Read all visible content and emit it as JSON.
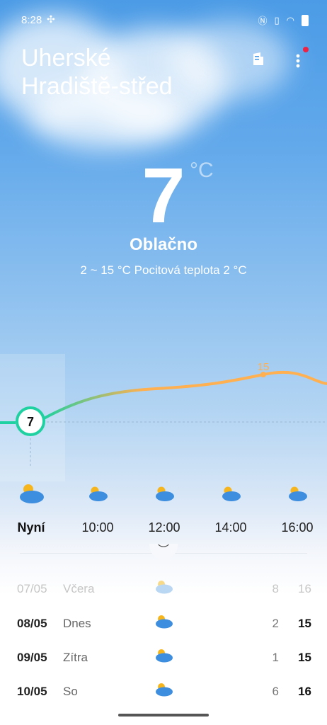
{
  "status": {
    "time": "8:28",
    "icons": [
      "fan-icon",
      "nfc-icon",
      "vibrate-icon",
      "wifi-icon",
      "battery-icon"
    ]
  },
  "header": {
    "city_line1": "Uherské",
    "city_line2": "Hradiště-střed",
    "notification_dot_color": "#ee2244"
  },
  "current": {
    "temp": "7",
    "unit": "°C",
    "condition": "Oblačno",
    "range": "2 ~ 15 °C  Pocitová teplota 2 °C"
  },
  "hourly": {
    "now_temp": "7",
    "peak_label": "15",
    "items": [
      {
        "label": "Nyní",
        "icon": "partly-cloudy-icon"
      },
      {
        "label": "10:00",
        "icon": "partly-cloudy-icon"
      },
      {
        "label": "12:00",
        "icon": "partly-cloudy-icon"
      },
      {
        "label": "14:00",
        "icon": "partly-cloudy-icon"
      },
      {
        "label": "16:00",
        "icon": "partly-cloudy-icon"
      }
    ]
  },
  "daily": [
    {
      "date": "07/05",
      "name": "Včera",
      "low": "8",
      "high": "16",
      "icon": "partly-cloudy-icon"
    },
    {
      "date": "08/05",
      "name": "Dnes",
      "low": "2",
      "high": "15",
      "icon": "partly-cloudy-icon"
    },
    {
      "date": "09/05",
      "name": "Zítra",
      "low": "1",
      "high": "15",
      "icon": "partly-cloudy-icon"
    },
    {
      "date": "10/05",
      "name": "So",
      "low": "6",
      "high": "16",
      "icon": "partly-cloudy-icon"
    }
  ],
  "colors": {
    "sky_top": "#4b9be6",
    "curve_start": "#1fd1a0",
    "curve_end": "#ffb050"
  }
}
